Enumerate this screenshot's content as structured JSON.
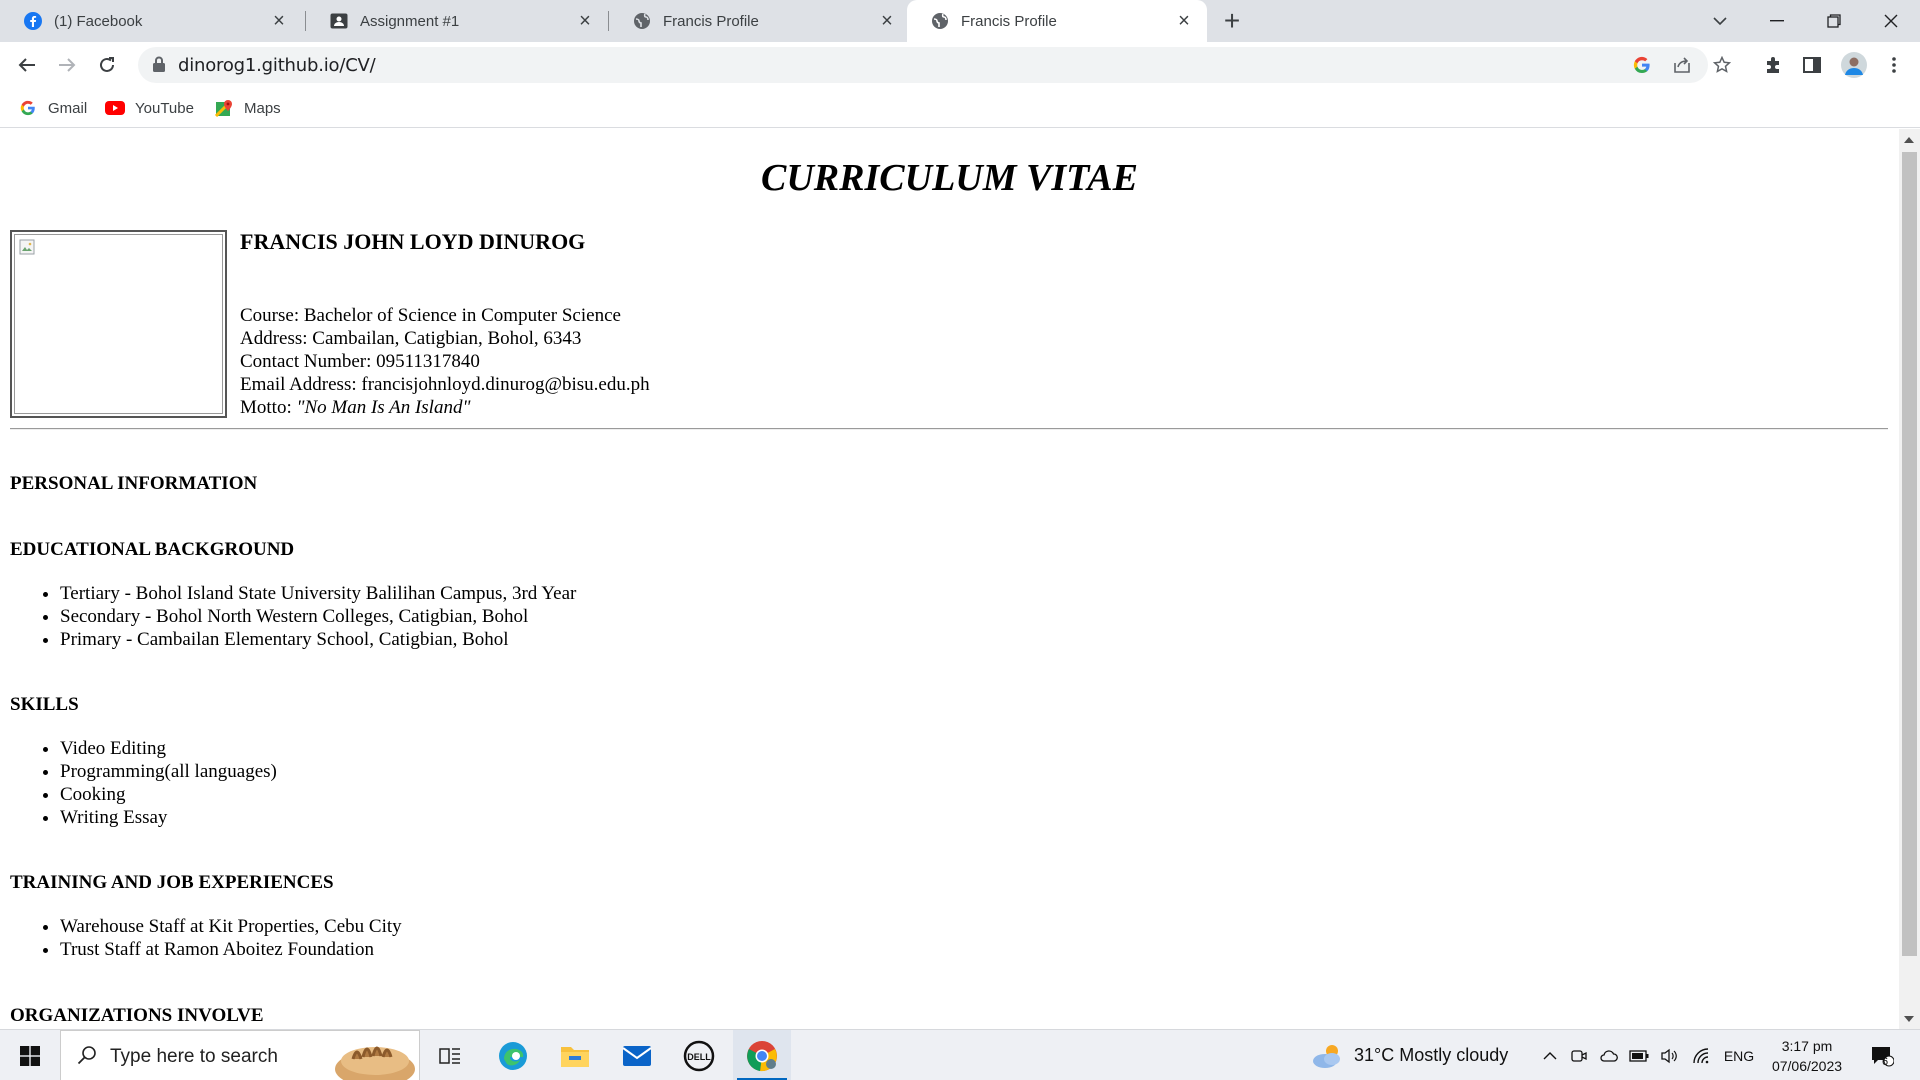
{
  "browser": {
    "tabs": [
      {
        "title": "(1) Facebook",
        "icon": "facebook-icon",
        "active": false
      },
      {
        "title": "Assignment #1",
        "icon": "classroom-icon",
        "active": false
      },
      {
        "title": "Francis Profile",
        "icon": "globe-icon",
        "active": false
      },
      {
        "title": "Francis Profile",
        "icon": "globe-icon",
        "active": true
      }
    ],
    "url": "dinorog1.github.io/CV/",
    "bookmarks": [
      {
        "label": "Gmail",
        "icon": "google-icon"
      },
      {
        "label": "YouTube",
        "icon": "youtube-icon"
      },
      {
        "label": "Maps",
        "icon": "maps-icon"
      }
    ]
  },
  "cv": {
    "title": "CURRICULUM VITAE",
    "name": "FRANCIS JOHN LOYD DINUROG",
    "course": "Course: Bachelor of Science in Computer Science",
    "address": "Address: Cambailan, Catigbian, Bohol, 6343",
    "contact": "Contact Number: 09511317840",
    "email": "Email Address: francisjohnloyd.dinurog@bisu.edu.ph",
    "motto_label": "Motto: ",
    "motto": "\"No Man Is An Island\"",
    "sections": {
      "personal": "PERSONAL INFORMATION",
      "education": "EDUCATIONAL BACKGROUND",
      "skills": "SKILLS",
      "training": "TRAINING AND JOB EXPERIENCES",
      "organizations": "ORGANIZATIONS INVOLVE"
    },
    "education": [
      "Tertiary - Bohol Island State University Balilihan Campus, 3rd Year",
      "Secondary - Bohol North Western Colleges, Catigbian, Bohol",
      "Primary - Cambailan Elementary School, Catigbian, Bohol"
    ],
    "skills": [
      "Video Editing",
      "Programming(all languages)",
      "Cooking",
      "Writing Essay"
    ],
    "training": [
      "Warehouse Staff at Kit Properties, Cebu City",
      "Trust Staff at Ramon Aboitez Foundation"
    ]
  },
  "taskbar": {
    "search_placeholder": "Type here to search",
    "weather": "31°C  Mostly cloudy",
    "language": "ENG",
    "time": "3:17 pm",
    "date": "07/06/2023",
    "notification_count": "6"
  },
  "colors": {
    "tabstrip": "#dee1e6",
    "omnibox": "#f1f3f4",
    "taskbar": "#eef0f4",
    "accent": "#0067c0"
  }
}
